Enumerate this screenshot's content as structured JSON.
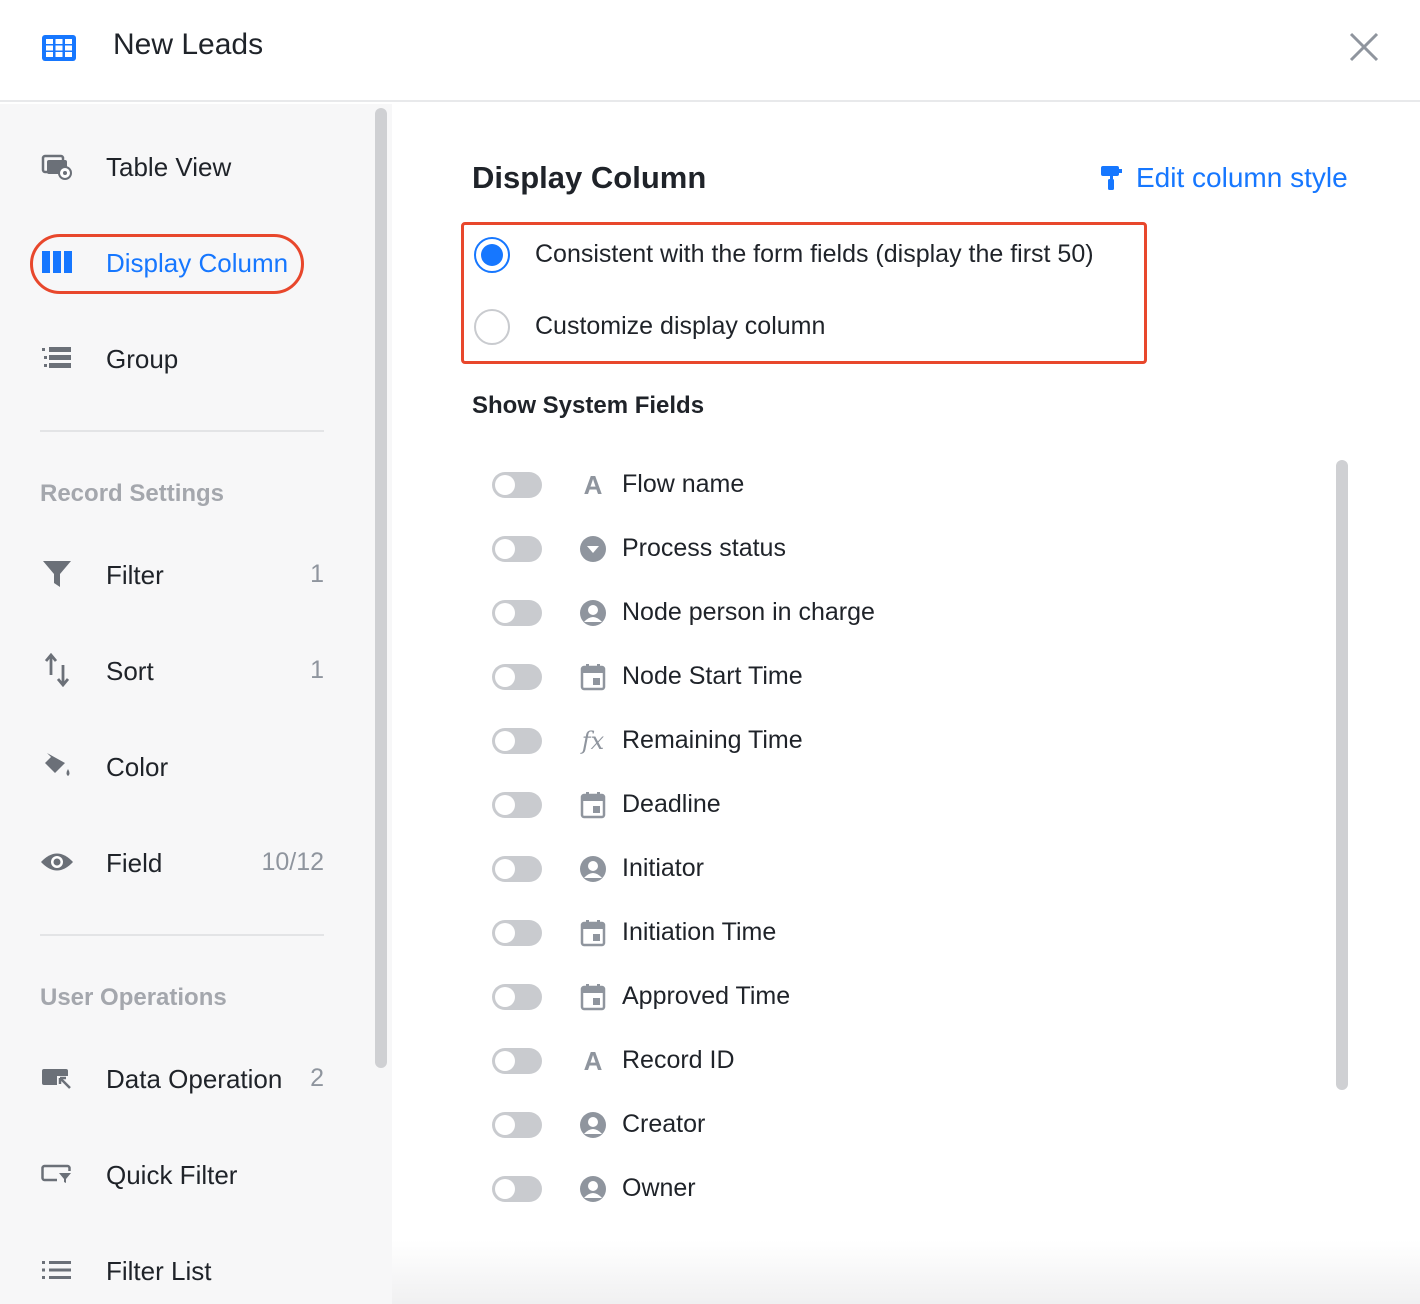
{
  "header": {
    "title": "New Leads",
    "app_icon": "grid-table-icon",
    "close_icon": "close-icon"
  },
  "sidebar": {
    "view_items": [
      {
        "label": "Table View",
        "icon": "table-view-icon"
      },
      {
        "label": "Display Column",
        "icon": "columns-icon",
        "active": true
      },
      {
        "label": "Group",
        "icon": "group-list-icon"
      }
    ],
    "record_settings_title": "Record Settings",
    "record_items": [
      {
        "label": "Filter",
        "count": "1",
        "icon": "filter-icon"
      },
      {
        "label": "Sort",
        "count": "1",
        "icon": "sort-icon"
      },
      {
        "label": "Color",
        "count": "",
        "icon": "paint-bucket-icon"
      },
      {
        "label": "Field",
        "count": "10/12",
        "icon": "eye-icon"
      }
    ],
    "user_operations_title": "User Operations",
    "user_items": [
      {
        "label": "Data Operation",
        "count": "2",
        "icon": "data-operation-icon"
      },
      {
        "label": "Quick Filter",
        "count": "",
        "icon": "quick-filter-icon"
      },
      {
        "label": "Filter List",
        "count": "",
        "icon": "list-icon"
      }
    ]
  },
  "main": {
    "heading": "Display Column",
    "edit_style_label": "Edit column style",
    "radio_options": [
      {
        "label": "Consistent with the form fields (display the first 50)",
        "checked": true
      },
      {
        "label": "Customize display column",
        "checked": false
      }
    ],
    "system_fields_title": "Show System Fields",
    "system_fields": [
      {
        "label": "Flow name",
        "icon": "text-icon",
        "enabled": false
      },
      {
        "label": "Process status",
        "icon": "dropdown-icon",
        "enabled": false
      },
      {
        "label": "Node person in charge",
        "icon": "person-icon",
        "enabled": false
      },
      {
        "label": "Node Start Time",
        "icon": "calendar-icon",
        "enabled": false
      },
      {
        "label": "Remaining Time",
        "icon": "formula-icon",
        "enabled": false
      },
      {
        "label": "Deadline",
        "icon": "calendar-icon",
        "enabled": false
      },
      {
        "label": "Initiator",
        "icon": "person-icon",
        "enabled": false
      },
      {
        "label": "Initiation Time",
        "icon": "calendar-icon",
        "enabled": false
      },
      {
        "label": "Approved Time",
        "icon": "calendar-icon",
        "enabled": false
      },
      {
        "label": "Record ID",
        "icon": "text-icon",
        "enabled": false
      },
      {
        "label": "Creator",
        "icon": "person-icon",
        "enabled": false
      },
      {
        "label": "Owner",
        "icon": "person-icon",
        "enabled": false
      }
    ]
  },
  "colors": {
    "accent": "#1677ff",
    "highlight_outline": "#e8472c",
    "toggle_off": "#c9cbcf",
    "muted_text": "#8f959e"
  }
}
